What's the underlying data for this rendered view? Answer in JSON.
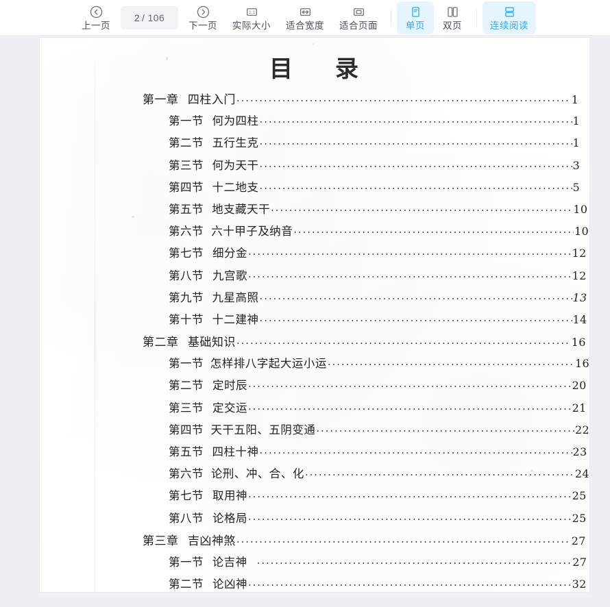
{
  "toolbar": {
    "prev": {
      "label": "上一页",
      "icon": "chevron-left-circle-icon"
    },
    "page_indicator": {
      "current": "2",
      "total": "/ 106"
    },
    "next": {
      "label": "下一页",
      "icon": "chevron-right-circle-icon"
    },
    "actual_size": {
      "label": "实际大小",
      "icon": "actual-size-icon",
      "icon_text": "1:1"
    },
    "fit_width": {
      "label": "适合宽度",
      "icon": "fit-width-icon"
    },
    "fit_page": {
      "label": "适合页面",
      "icon": "fit-page-icon"
    },
    "single_page": {
      "label": "单页",
      "icon": "single-page-icon",
      "active": true
    },
    "double_page": {
      "label": "双页",
      "icon": "double-page-icon",
      "active": false
    },
    "continuous": {
      "label": "连续阅读",
      "icon": "continuous-scroll-icon",
      "active": true
    },
    "accent_color": "#2eade8",
    "accent_bg": "#e6f4fe",
    "text_color": "#4a4f5c"
  },
  "document": {
    "title_left": "目",
    "title_right": "录",
    "toc": [
      {
        "level": 1,
        "num": "第一章",
        "title": "四柱入门",
        "page": "1"
      },
      {
        "level": 2,
        "num": "第一节",
        "title": "何为四柱",
        "page": "1"
      },
      {
        "level": 2,
        "num": "第二节",
        "title": "五行生克",
        "page": "1"
      },
      {
        "level": 2,
        "num": "第三节",
        "title": "何为天干",
        "page": "3"
      },
      {
        "level": 2,
        "num": "第四节",
        "title": "十二地支",
        "page": "5"
      },
      {
        "level": 2,
        "num": "第五节",
        "title": "地支藏天干",
        "page": "10"
      },
      {
        "level": 2,
        "num": "第六节",
        "title": "六十甲子及纳音",
        "page": "10"
      },
      {
        "level": 2,
        "num": "第七节",
        "title": "细分金",
        "page": "12"
      },
      {
        "level": 2,
        "num": "第八节",
        "title": "九宫歌",
        "page": "12"
      },
      {
        "level": 2,
        "num": "第九节",
        "title": "九星高照",
        "page": "13",
        "italic": true
      },
      {
        "level": 2,
        "num": "第十节",
        "title": "十二建神",
        "page": "14"
      },
      {
        "level": 1,
        "num": "第二章",
        "title": "基础知识",
        "page": "16"
      },
      {
        "level": 2,
        "num": "第一节",
        "title": "怎样排八字起大运小运",
        "page": "16"
      },
      {
        "level": 2,
        "num": "第二节",
        "title": "定时辰",
        "page": "20"
      },
      {
        "level": 2,
        "num": "第三节",
        "title": "定交运",
        "page": "21"
      },
      {
        "level": 2,
        "num": "第四节",
        "title": "天干五阳、五阴变通",
        "page": "22"
      },
      {
        "level": 2,
        "num": "第五节",
        "title": "四柱十神",
        "page": "23"
      },
      {
        "level": 2,
        "num": "第六节",
        "title": "论刑、冲、合、化",
        "page": "24"
      },
      {
        "level": 2,
        "num": "第七节",
        "title": "取用神",
        "page": "25"
      },
      {
        "level": 2,
        "num": "第八节",
        "title": "论格局",
        "page": "25"
      },
      {
        "level": 1,
        "num": "第三章",
        "title": "吉凶神煞",
        "page": "27"
      },
      {
        "level": 2,
        "num": "第一节",
        "title": "论吉神",
        "page": "27",
        "gapdots": true
      },
      {
        "level": 2,
        "num": "第二节",
        "title": "论凶神",
        "page": "32",
        "clipped": true
      }
    ]
  }
}
